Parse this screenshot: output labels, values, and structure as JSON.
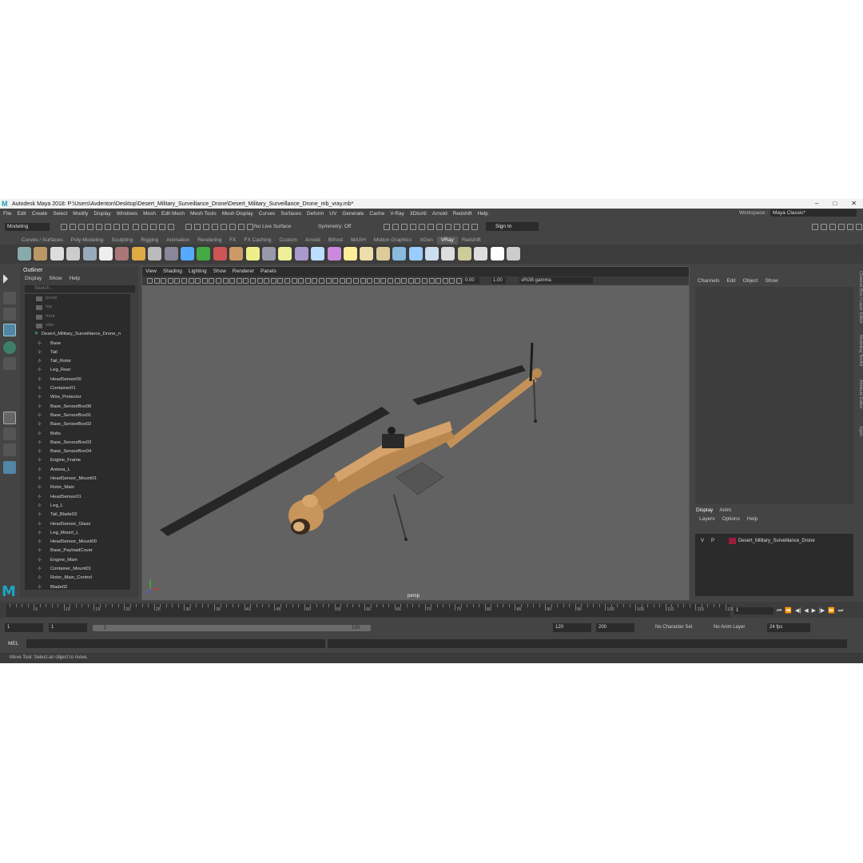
{
  "window": {
    "title": "Autodesk Maya 2018: P:\\Users\\Avdenton\\Desktop\\Desert_Military_Surveillance_Drone\\Desert_Military_Surveillance_Drone_mb_vray.mb*",
    "minimize": "–",
    "maximize": "□",
    "close": "✕"
  },
  "menubar": [
    "File",
    "Edit",
    "Create",
    "Select",
    "Modify",
    "Display",
    "Windows",
    "Mesh",
    "Edit Mesh",
    "Mesh Tools",
    "Mesh Display",
    "Curves",
    "Surfaces",
    "Deform",
    "UV",
    "Generate",
    "Cache",
    "V-Ray",
    "3DtoAll",
    "Arnold",
    "Redshift",
    "Help"
  ],
  "workspace": {
    "label": "Workspace :",
    "value": "Maya Classic*"
  },
  "status": {
    "mode": "Modeling",
    "live_surface": "No Live Surface",
    "symmetry": "Symmetry: Off",
    "sign_in": "Sign In"
  },
  "shelf_tabs": [
    "Curves / Surfaces",
    "Poly Modeling",
    "Sculpting",
    "Rigging",
    "Animation",
    "Rendering",
    "FX",
    "FX Caching",
    "Custom",
    "Arnold",
    "Bifrost",
    "MASH",
    "Motion Graphics",
    "XGen",
    "VRay",
    "Redshift"
  ],
  "active_shelf_tab": "VRay",
  "outliner": {
    "title": "Outliner",
    "menu": [
      "Display",
      "Show",
      "Help"
    ],
    "search_placeholder": "Search...",
    "cameras": [
      "persp",
      "top",
      "front",
      "side"
    ],
    "root": "Desert_Military_Surveillance_Drone_n",
    "items": [
      "Base",
      "Tail",
      "Tail_Rotor",
      "Leg_Rear",
      "HeadSensor00",
      "Container01",
      "Wire_Protector",
      "Base_SensorBox00",
      "Base_SensorBox01",
      "Base_SensorBox02",
      "Bolts",
      "Base_SensorBox03",
      "Base_SensorBox04",
      "Engine_Frame",
      "Antena_L",
      "HeadSensor_Mount01",
      "Rotor_Main",
      "HeadSensor01",
      "Leg_L",
      "Tail_Blade03",
      "HeadSensor_Glass",
      "Leg_Mount_L",
      "HeadSensor_Mount00",
      "Base_PayloadCover",
      "Engine_Main",
      "Container_Mount01",
      "Rotor_Main_Control",
      "Blade02"
    ]
  },
  "viewport": {
    "menu": [
      "View",
      "Shading",
      "Lighting",
      "Show",
      "Renderer",
      "Panels"
    ],
    "exposure": "0.00",
    "gamma": "1.00",
    "color_space": "sRGB gamma",
    "camera_label": "persp"
  },
  "channel_box": {
    "menu": [
      "Channels",
      "Edit",
      "Object",
      "Show"
    ]
  },
  "layers": {
    "tabs": [
      "Display",
      "Anim"
    ],
    "menu": [
      "Layers",
      "Options",
      "Help"
    ],
    "layer_v": "V",
    "layer_p": "P",
    "layer_name": "Desert_Military_Surveillance_Drone"
  },
  "side_tabs": [
    "Channel Box / Layer Editor",
    "Modeling Toolkit",
    "Attribute Editor",
    "Xgen"
  ],
  "timeline": {
    "ticks": [
      "5",
      "10",
      "15",
      "20",
      "25",
      "30",
      "35",
      "40",
      "45",
      "50",
      "55",
      "60",
      "65",
      "70",
      "75",
      "80",
      "85",
      "90",
      "95",
      "100",
      "105",
      "110",
      "115",
      "120"
    ],
    "current_frame": "1",
    "playback": [
      "⏮",
      "⏪",
      "◀|",
      "◀",
      "▶",
      "|▶",
      "⏩",
      "⏭"
    ]
  },
  "range": {
    "start": "1",
    "anim_start": "1",
    "slider_start": "1",
    "slider_end": "120",
    "end": "120",
    "anim_end": "200",
    "character_set": "No Character Set",
    "anim_layer": "No Anim Layer",
    "fps": "24 fps"
  },
  "command": {
    "mel": "MEL"
  },
  "help_line": "Move Tool: Select an object to move.",
  "colors": {
    "accent": "#5285a6",
    "layer_swatch": "#9a1e3a",
    "drone_body": "#c4925c"
  }
}
